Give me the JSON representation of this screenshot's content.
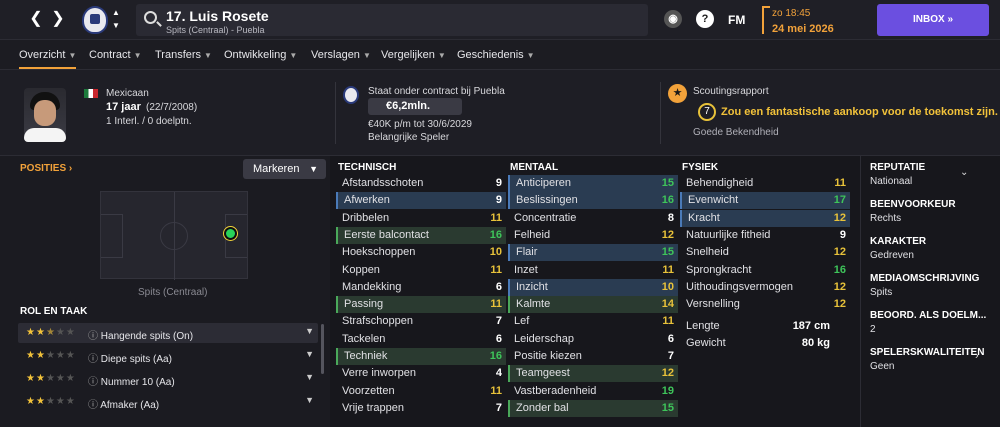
{
  "header": {
    "player_name": "17. Luis Rosete",
    "player_sub": "Spits (Centraal) - Puebla",
    "fm": "FM",
    "time": "zo 18:45",
    "date": "24 mei 2026",
    "inbox": "INBOX",
    "help": "?"
  },
  "tabs": [
    {
      "label": "Overzicht"
    },
    {
      "label": "Contract"
    },
    {
      "label": "Transfers"
    },
    {
      "label": "Ontwikkeling"
    },
    {
      "label": "Verslagen"
    },
    {
      "label": "Vergelijken"
    },
    {
      "label": "Geschiedenis"
    }
  ],
  "profile": {
    "nationality": "Mexicaan",
    "age": "17 jaar",
    "dob": "(22/7/2008)",
    "caps": "1 Interl. / 0 doelptn."
  },
  "contract": {
    "title": "Staat onder contract bij Puebla",
    "value": "€6,2mln.",
    "wage": "€40K p/m tot 30/6/2029",
    "status": "Belangrijke Speler"
  },
  "scouting": {
    "title": "Scoutingsrapport",
    "rating": "7",
    "text": "Zou een fantastische aankoop voor de toekomst zijn.",
    "label": "Goede Bekendheid"
  },
  "positions": {
    "title": "POSITIES",
    "button": "Markeren",
    "position_label": "Spits (Centraal)"
  },
  "roles": {
    "title": "ROL EN TAAK",
    "items": [
      {
        "label": "Hangende spits (On)",
        "stars": 2.5
      },
      {
        "label": "Diepe spits (Aa)",
        "stars": 2
      },
      {
        "label": "Nummer 10 (Aa)",
        "stars": 2
      },
      {
        "label": "Afmaker (Aa)",
        "stars": 2
      }
    ]
  },
  "technical": {
    "title": "TECHNISCH",
    "items": [
      {
        "name": "Afstandsschoten",
        "value": 9,
        "hl": ""
      },
      {
        "name": "Afwerken",
        "value": 9,
        "hl": "blue"
      },
      {
        "name": "Dribbelen",
        "value": 11,
        "hl": ""
      },
      {
        "name": "Eerste balcontact",
        "value": 16,
        "hl": "green"
      },
      {
        "name": "Hoekschoppen",
        "value": 10,
        "hl": ""
      },
      {
        "name": "Koppen",
        "value": 11,
        "hl": ""
      },
      {
        "name": "Mandekking",
        "value": 6,
        "hl": ""
      },
      {
        "name": "Passing",
        "value": 11,
        "hl": "green"
      },
      {
        "name": "Strafschoppen",
        "value": 7,
        "hl": ""
      },
      {
        "name": "Tackelen",
        "value": 6,
        "hl": ""
      },
      {
        "name": "Techniek",
        "value": 16,
        "hl": "green"
      },
      {
        "name": "Verre inworpen",
        "value": 4,
        "hl": ""
      },
      {
        "name": "Voorzetten",
        "value": 11,
        "hl": ""
      },
      {
        "name": "Vrije trappen",
        "value": 7,
        "hl": ""
      }
    ]
  },
  "mental": {
    "title": "MENTAAL",
    "items": [
      {
        "name": "Anticiperen",
        "value": 15,
        "hl": "blue"
      },
      {
        "name": "Beslissingen",
        "value": 16,
        "hl": "blue"
      },
      {
        "name": "Concentratie",
        "value": 8,
        "hl": ""
      },
      {
        "name": "Felheid",
        "value": 12,
        "hl": ""
      },
      {
        "name": "Flair",
        "value": 15,
        "hl": "blue"
      },
      {
        "name": "Inzet",
        "value": 11,
        "hl": ""
      },
      {
        "name": "Inzicht",
        "value": 10,
        "hl": "blue"
      },
      {
        "name": "Kalmte",
        "value": 14,
        "hl": "green"
      },
      {
        "name": "Lef",
        "value": 11,
        "hl": ""
      },
      {
        "name": "Leiderschap",
        "value": 6,
        "hl": ""
      },
      {
        "name": "Positie kiezen",
        "value": 7,
        "hl": ""
      },
      {
        "name": "Teamgeest",
        "value": 12,
        "hl": "green"
      },
      {
        "name": "Vastberadenheid",
        "value": 19,
        "hl": ""
      },
      {
        "name": "Zonder bal",
        "value": 15,
        "hl": "green"
      }
    ]
  },
  "physical": {
    "title": "FYSIEK",
    "items": [
      {
        "name": "Behendigheid",
        "value": 11,
        "hl": ""
      },
      {
        "name": "Evenwicht",
        "value": 17,
        "hl": "blue"
      },
      {
        "name": "Kracht",
        "value": 12,
        "hl": "blue"
      },
      {
        "name": "Natuurlijke fitheid",
        "value": 9,
        "hl": ""
      },
      {
        "name": "Snelheid",
        "value": 12,
        "hl": ""
      },
      {
        "name": "Sprongkracht",
        "value": 16,
        "hl": ""
      },
      {
        "name": "Uithoudingsvermogen",
        "value": 12,
        "hl": ""
      },
      {
        "name": "Versnelling",
        "value": 12,
        "hl": ""
      }
    ],
    "extra": [
      {
        "name": "Lengte",
        "value": "187 cm"
      },
      {
        "name": "Gewicht",
        "value": "80 kg"
      }
    ]
  },
  "side": [
    {
      "head": "REPUTATIE",
      "val": "Nationaal"
    },
    {
      "head": "BEENVOORKEUR",
      "val": "Rechts"
    },
    {
      "head": "KARAKTER",
      "val": "Gedreven"
    },
    {
      "head": "MEDIAOMSCHRIJVING",
      "val": "Spits"
    },
    {
      "head": "BEOORD. ALS DOELM...",
      "val": "2"
    },
    {
      "head": "SPELERSKWALITEITEN",
      "val": "Geen"
    }
  ],
  "colors": {
    "accent": "#f2a23a",
    "inbox": "#6b4fe0",
    "val_high": "#3ec45a",
    "val_mid": "#e8c23a",
    "val_low": "#ffffff"
  }
}
